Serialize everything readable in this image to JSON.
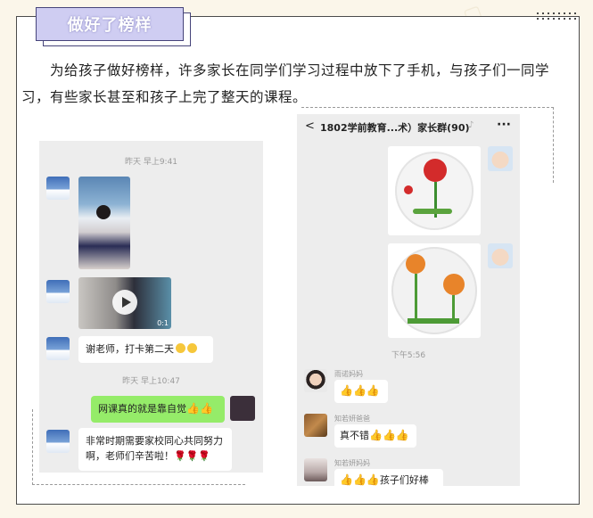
{
  "section": {
    "title": "做好了榜样"
  },
  "paragraph": "为给孩子做好榜样，许多家长在同学们学习过程中放下了手机，与孩子们一同学习，有些家长甚至和孩子上完了整天的课程。",
  "left_chat": {
    "timestamp_1": "昨天 早上9:41",
    "video_duration": "0:1",
    "msg_1": "谢老师，打卡第二天",
    "timestamp_2": "昨天 早上10:47",
    "msg_2": "网课真的就是靠自觉",
    "msg_3": "非常时期需要家校同心共同努力啊，老师们辛苦啦！"
  },
  "right_chat": {
    "group_name": "1802学前教育...术）家长群(90)",
    "timestamp": "下午5:56",
    "messages": [
      {
        "sender": "雨诺妈妈",
        "text": ""
      },
      {
        "sender": "知若妍爸爸",
        "text": "真不错"
      },
      {
        "sender": "知若妍妈妈",
        "text": "孩子们好棒"
      }
    ]
  },
  "colors": {
    "title_bg": "#cfcdf2",
    "bubble_green": "#95ec69",
    "chat_bg": "#ededed"
  }
}
